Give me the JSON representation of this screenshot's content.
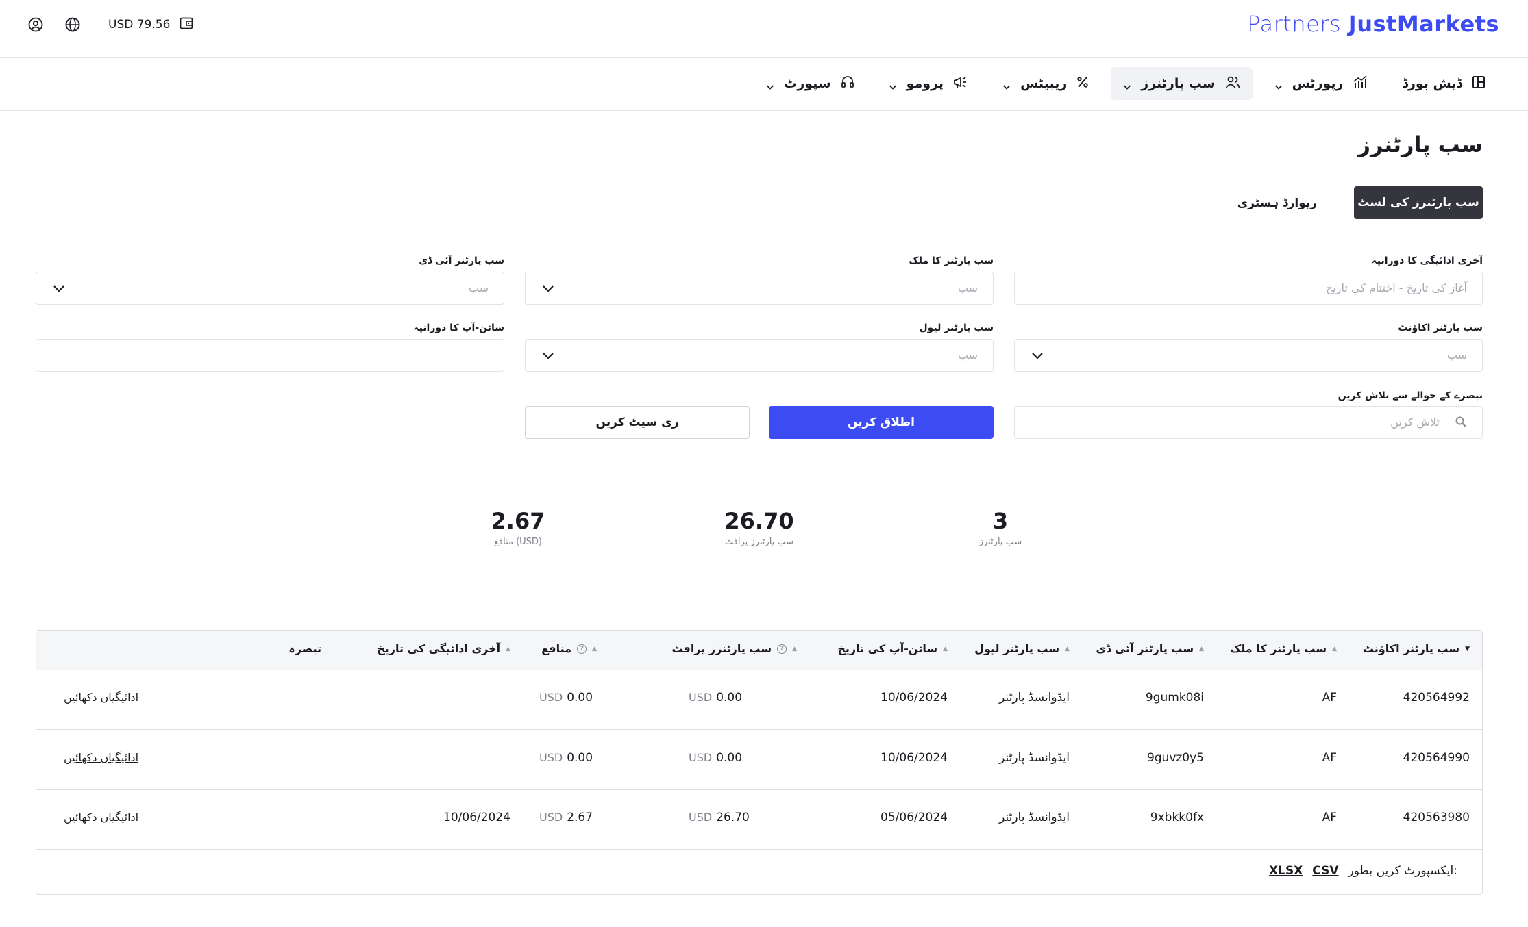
{
  "header": {
    "logo_light": "Partners ",
    "logo_bold": "JustMarkets",
    "balance": "USD 79.56"
  },
  "nav": [
    {
      "label": "ڈیش بورڈ",
      "icon": "dashboard-icon"
    },
    {
      "label": "رپورٹس",
      "icon": "chart-icon"
    },
    {
      "label": "سب پارٹنرز",
      "icon": "users-icon",
      "active": true
    },
    {
      "label": "ریبیٹس",
      "icon": "percent-icon"
    },
    {
      "label": "پرومو",
      "icon": "megaphone-icon"
    },
    {
      "label": "سپورٹ",
      "icon": "headset-icon"
    }
  ],
  "page": {
    "title": "سب پارٹنرز",
    "tab_list": "سب پارٹنرز کی لسٹ",
    "tab_history": "ریوارڈ ہسٹری"
  },
  "filters": {
    "last_payment_period": {
      "label": "آخری ادائیگی کا دورانیہ",
      "placeholder": "آغاز کی تاریخ - اختتام کی تاریخ"
    },
    "country": {
      "label": "سب پارٹنر کا ملک",
      "placeholder": "سب"
    },
    "id": {
      "label": "سب پارٹنر آئی ڈی",
      "placeholder": "سب"
    },
    "account": {
      "label": "سب پارٹنر اکاؤنٹ",
      "placeholder": "سب"
    },
    "level": {
      "label": "سب پارٹنر لیول",
      "placeholder": "سب"
    },
    "signup_period": {
      "label": "سائن-آپ کا دورانیہ",
      "placeholder": ""
    },
    "comment_search": {
      "label": "تبصرے کے حوالے سے تلاش کریں",
      "placeholder": "تلاش کریں"
    },
    "apply": "اطلاق کریں",
    "reset": "ری سیٹ کریں"
  },
  "stats": [
    {
      "value": "3",
      "label": "سب پارٹنرز"
    },
    {
      "value": "26.70",
      "label": "سب پارٹنرز پرافٹ"
    },
    {
      "value": "2.67",
      "label": "منافع (USD)"
    }
  ],
  "table": {
    "headers": {
      "account": "سب پارٹنر اکاؤنٹ",
      "country": "سب پارٹنر کا ملک",
      "id": "سب پارٹنر آئی ڈی",
      "level": "سب پارٹنر لیول",
      "signup": "سائن-آپ کی تاریخ",
      "profit": "سب پارٹنرز پرافٹ",
      "benefit": "منافع",
      "last_payment": "آخری ادائیگی کی تاریخ",
      "comment": "تبصرہ"
    },
    "rows": [
      {
        "account": "420564992",
        "country": "AF",
        "id": "9gumk08i",
        "level": "ایڈوانسڈ پارٹنر",
        "signup": "10/06/2024",
        "profit_cur": "USD",
        "profit": "0.00",
        "benefit_cur": "USD",
        "benefit": "0.00",
        "last_payment": "",
        "comment_link": "ادائیگیاں دکھائیں"
      },
      {
        "account": "420564990",
        "country": "AF",
        "id": "9guvz0y5",
        "level": "ایڈوانسڈ پارٹنر",
        "signup": "10/06/2024",
        "profit_cur": "USD",
        "profit": "0.00",
        "benefit_cur": "USD",
        "benefit": "0.00",
        "last_payment": "",
        "comment_link": "ادائیگیاں دکھائیں"
      },
      {
        "account": "420563980",
        "country": "AF",
        "id": "9xbkk0fx",
        "level": "ایڈوانسڈ پارٹنر",
        "signup": "05/06/2024",
        "profit_cur": "USD",
        "profit": "26.70",
        "benefit_cur": "USD",
        "benefit": "2.67",
        "last_payment": "10/06/2024",
        "comment_link": "ادائیگیاں دکھائیں"
      }
    ],
    "export_label": "ایکسپورٹ کریں بطور:",
    "export_csv": "CSV",
    "export_xlsx": "XLSX"
  }
}
